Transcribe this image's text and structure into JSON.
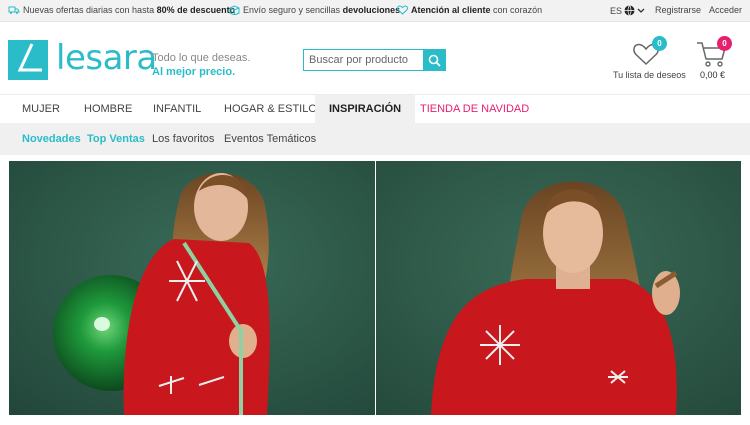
{
  "topbar": {
    "offer_pre": "Nuevas ofertas diarias con hasta",
    "offer_bold": "80% de descuento",
    "shipping_pre": "Envío seguro y sencillas",
    "shipping_bold": "devoluciones",
    "service_bold": "Atención al cliente",
    "service_post": "con corazón",
    "language": "ES",
    "register": "Registrarse",
    "login": "Acceder"
  },
  "header": {
    "logo_text": "lesara",
    "tagline_1": "Todo lo que deseas.",
    "tagline_2": "Al mejor precio.",
    "search_placeholder": "Buscar por producto",
    "wishlist_label": "Tu lista de deseos",
    "wishlist_count": "0",
    "cart_total": "0,00 €",
    "cart_count": "0"
  },
  "nav": {
    "items": [
      "Mujer",
      "Hombre",
      "Infantil",
      "Hogar & Estilo",
      "Inspiración",
      "Tienda de Navidad"
    ]
  },
  "subnav": {
    "items": [
      "Novedades",
      "Top Ventas",
      "Los favoritos",
      "Eventos Temáticos"
    ]
  },
  "colors": {
    "brand": "#2bbcc9",
    "christmas": "#e6206e",
    "wishlist_badge": "#2bbcc9",
    "cart_badge": "#e6206e",
    "hero_background": "#2e5a4a",
    "sweater": "#c8181e"
  },
  "icons": [
    "truck-icon",
    "box-icon",
    "heart-icon",
    "globe-icon",
    "chevron-down-icon",
    "search-icon",
    "wishlist-heart-icon",
    "cart-icon"
  ]
}
